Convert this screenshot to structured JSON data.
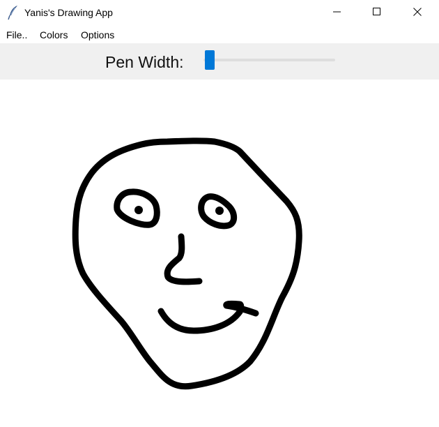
{
  "window": {
    "title": "Yanis's Drawing App"
  },
  "icons": {
    "app": "feather-icon",
    "minimize": "minimize-icon",
    "maximize": "maximize-icon",
    "close": "close-icon"
  },
  "menu": {
    "file": "File..",
    "colors": "Colors",
    "options": "Options"
  },
  "toolbar": {
    "pen_width_label": "Pen Width:",
    "pen_width_value": 0.02
  },
  "colors": {
    "toolbar_bg": "#f0f0f0",
    "slider_accent": "#0078d7",
    "ink": "#000000"
  }
}
